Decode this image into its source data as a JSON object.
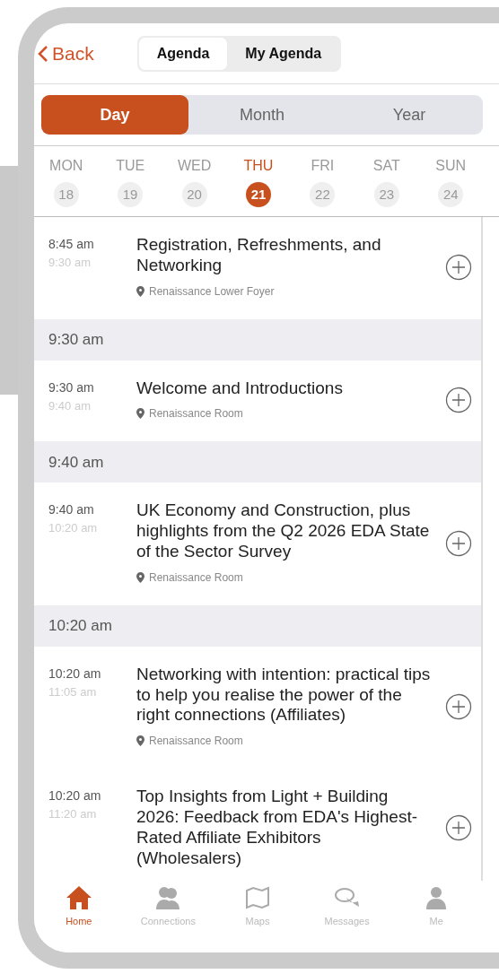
{
  "header": {
    "back": "Back",
    "segments": [
      {
        "label": "Agenda",
        "selected": true
      },
      {
        "label": "My Agenda",
        "selected": false
      }
    ]
  },
  "view_tabs": [
    {
      "label": "Day",
      "selected": true
    },
    {
      "label": "Month",
      "selected": false
    },
    {
      "label": "Year",
      "selected": false
    }
  ],
  "week": [
    {
      "day": "MON",
      "date": "18",
      "selected": false
    },
    {
      "day": "TUE",
      "date": "19",
      "selected": false
    },
    {
      "day": "WED",
      "date": "20",
      "selected": false
    },
    {
      "day": "THU",
      "date": "21",
      "selected": true
    },
    {
      "day": "FRI",
      "date": "22",
      "selected": false
    },
    {
      "day": "SAT",
      "date": "23",
      "selected": false
    },
    {
      "day": "SUN",
      "date": "24",
      "selected": false
    }
  ],
  "agenda": [
    {
      "kind": "event",
      "start": "8:45 am",
      "end": "9:30 am",
      "title": "Registration, Refreshments, and Networking",
      "location": "Renaissance Lower Foyer"
    },
    {
      "kind": "header",
      "time": "9:30 am"
    },
    {
      "kind": "event",
      "start": "9:30 am",
      "end": "9:40 am",
      "title": "Welcome and Introductions",
      "location": "Renaissance Room"
    },
    {
      "kind": "header",
      "time": "9:40 am"
    },
    {
      "kind": "event",
      "start": "9:40 am",
      "end": "10:20 am",
      "title": "UK Economy and Construction, plus highlights from the Q2 2026 EDA State of the Sector Survey",
      "location": "Renaissance Room"
    },
    {
      "kind": "header",
      "time": "10:20 am"
    },
    {
      "kind": "event",
      "start": "10:20 am",
      "end": "11:05 am",
      "title": "Networking with intention: practical tips to help you realise the power of the right connections (Affiliates)",
      "location": "Renaissance Room"
    },
    {
      "kind": "event",
      "start": "10:20 am",
      "end": "11:20 am",
      "title": "Top Insights from Light + Building 2026: Feedback from EDA's Highest-Rated Affiliate Exhibitors (Wholesalers)"
    }
  ],
  "tab_bar": [
    {
      "label": "Home",
      "kind": "home",
      "selected": true
    },
    {
      "label": "Connections",
      "kind": "people",
      "selected": false
    },
    {
      "label": "Maps",
      "kind": "map",
      "selected": false
    },
    {
      "label": "Messages",
      "kind": "chat",
      "selected": false
    },
    {
      "label": "Me",
      "kind": "person",
      "selected": false
    }
  ]
}
